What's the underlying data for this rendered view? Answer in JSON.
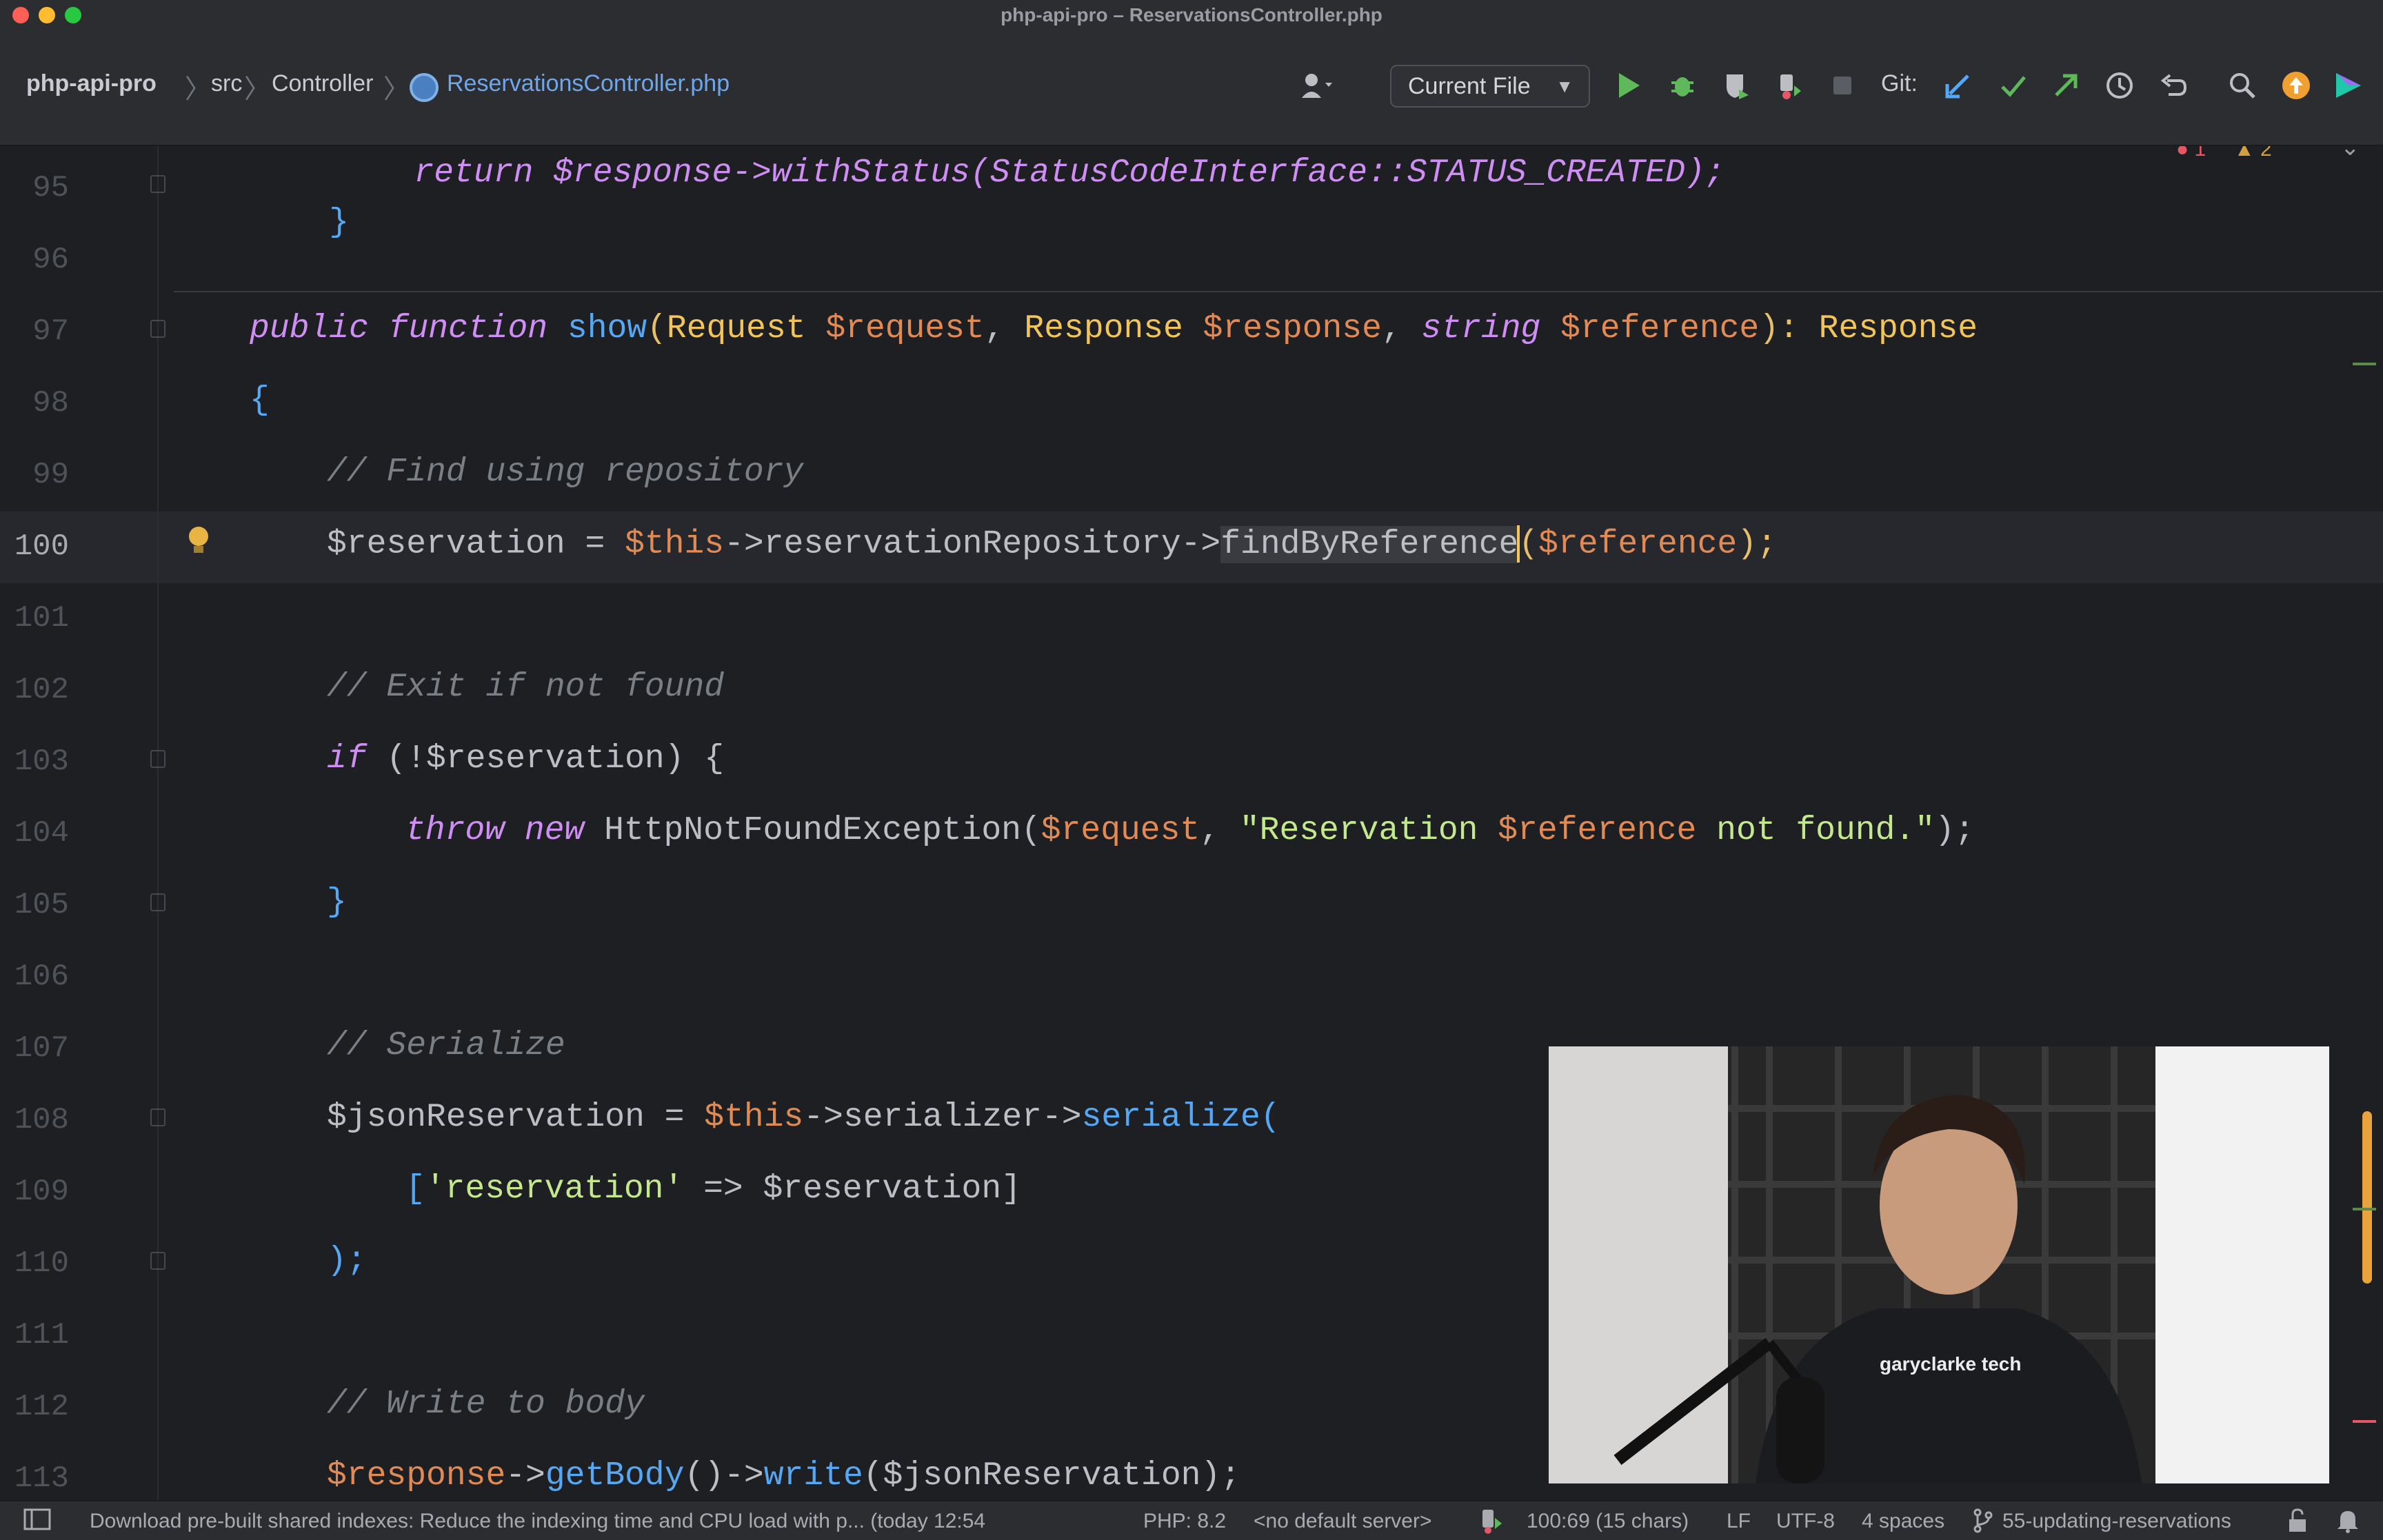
{
  "window": {
    "title": "php-api-pro – ReservationsController.php"
  },
  "breadcrumb": {
    "project": "php-api-pro",
    "dir1": "src",
    "dir2": "Controller",
    "file": "ReservationsController.php"
  },
  "toolbar": {
    "run_config": "Current File",
    "git_label": "Git:"
  },
  "inspections": {
    "errors": "1",
    "warnings": "2"
  },
  "editor": {
    "top_partial": "    return $response->withStatus(StatusCodeInterface::STATUS_CREATED);",
    "line_numbers": [
      "95",
      "96",
      "97",
      "98",
      "99",
      "100",
      "101",
      "102",
      "103",
      "104",
      "105",
      "106",
      "107",
      "108",
      "109",
      "110",
      "111",
      "112",
      "113"
    ],
    "current_line": "100",
    "code": {
      "l95_brace": "}",
      "l97_public": "public",
      "l97_function": "function",
      "l97_name": "show",
      "l97_p1": "(",
      "l97_t1": "Request",
      "l97_v1": "$request",
      "l97_c1": ", ",
      "l97_t2": "Response",
      "l97_v2": "$response",
      "l97_c2": ", ",
      "l97_t3": "string",
      "l97_v3": "$reference",
      "l97_p2": "): ",
      "l97_rt": "Response",
      "l98": "{",
      "l99": "// Find using repository",
      "l100_a": "$reservation = ",
      "l100_this": "$this",
      "l100_b": "->reservationRepository->",
      "l100_sel": "findByReference",
      "l100_c": "(",
      "l100_arg": "$reference",
      "l100_d": ");",
      "l102": "// Exit if not found",
      "l103_if": "if",
      "l103_rest": " (!$reservation) {",
      "l104_throw": "throw",
      "l104_new": "new",
      "l104_cls": " HttpNotFoundException(",
      "l104_req": "$request",
      "l104_comma": ", ",
      "l104_str1": "\"Reservation ",
      "l104_strvar": "$reference",
      "l104_str2": " not found.\"",
      "l104_end": ");",
      "l105": "}",
      "l107": "// Serialize",
      "l108_a": "$jsonReservation = ",
      "l108_this": "$this",
      "l108_b": "->serializer->",
      "l108_fn": "serialize",
      "l108_c": "(",
      "l109_a": "[",
      "l109_str": "'reservation'",
      "l109_b": " => $reservation]",
      "l110": ");",
      "l112": "// Write to body",
      "l113_a": "$response",
      "l113_b": "->",
      "l113_fn1": "getBody",
      "l113_c": "()->",
      "l113_fn2": "write",
      "l113_d": "($jsonReservation);"
    }
  },
  "statusbar": {
    "message": "Download pre-built shared indexes: Reduce the indexing time and CPU load with p... (today 12:54",
    "php": "PHP: 8.2",
    "server": "<no default server>",
    "position": "100:69 (15 chars)",
    "line_sep": "LF",
    "encoding": "UTF-8",
    "indent": "4 spaces",
    "branch": "55-updating-reservations"
  },
  "colors": {
    "accent": "#56a8f5",
    "error": "#e55765",
    "warning": "#d0a040",
    "run": "#5fb85a"
  },
  "icons": [
    "user-icon",
    "run-icon",
    "debug-icon",
    "coverage-icon",
    "profile-icon",
    "stop-icon",
    "git-update-icon",
    "git-commit-icon",
    "git-push-icon",
    "history-icon",
    "rollback-icon",
    "search-icon",
    "update-icon",
    "ide-icon"
  ]
}
